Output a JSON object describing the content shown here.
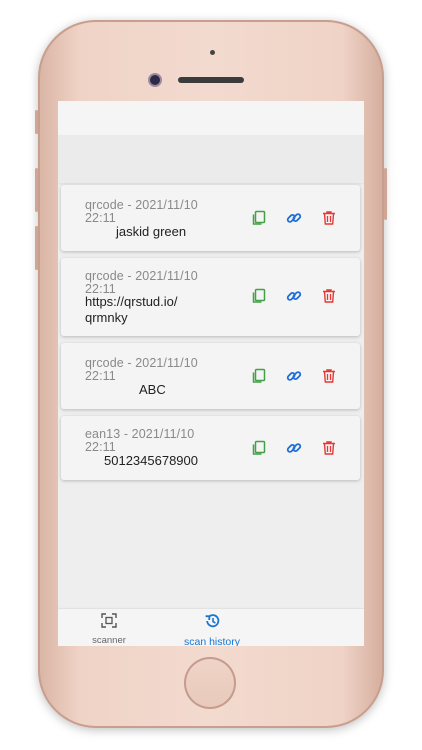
{
  "history": {
    "items": [
      {
        "meta": "qrcode - 2021/11/10 22:11",
        "value": "jaskid green"
      },
      {
        "meta": "qrcode - 2021/11/10 22:11",
        "value": "https://qrstud.io/qrmnky"
      },
      {
        "meta": "qrcode - 2021/11/10 22:11",
        "value": "ABC"
      },
      {
        "meta": "ean13 - 2021/11/10 22:11",
        "value": "5012345678900"
      }
    ],
    "action_icons": [
      "copy-icon",
      "link-icon",
      "trash-icon"
    ]
  },
  "bottom_nav": {
    "items": [
      {
        "label": "scanner",
        "icon": "scanner-icon",
        "active": false
      },
      {
        "label": "scan history",
        "icon": "history-icon",
        "active": true
      }
    ]
  },
  "colors": {
    "copy": "#43a047",
    "link": "#1e6fd9",
    "delete": "#e53935",
    "active_nav": "#1976d2"
  }
}
